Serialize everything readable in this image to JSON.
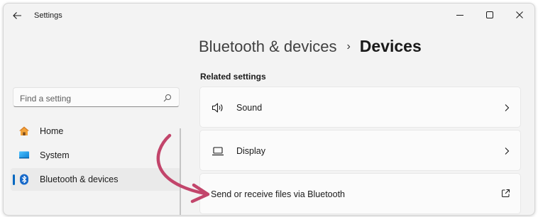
{
  "window": {
    "title": "Settings"
  },
  "header": {
    "parent": "Bluetooth & devices",
    "separator": "›",
    "current": "Devices"
  },
  "search": {
    "placeholder": "Find a setting"
  },
  "sidebar": {
    "items": [
      {
        "label": "Home",
        "icon": "home-icon",
        "active": false
      },
      {
        "label": "System",
        "icon": "system-icon",
        "active": false
      },
      {
        "label": "Bluetooth & devices",
        "icon": "bluetooth-icon",
        "active": true
      }
    ]
  },
  "main": {
    "section_title": "Related settings",
    "cards": [
      {
        "label": "Sound",
        "icon": "speaker-icon",
        "action": "chevron-right-icon"
      },
      {
        "label": "Display",
        "icon": "laptop-icon",
        "action": "chevron-right-icon"
      },
      {
        "label": "Send or receive files via Bluetooth",
        "icon": "",
        "action": "external-link-icon"
      }
    ]
  },
  "colors": {
    "accent": "#0067c0",
    "annotation_arrow": "#c2456b",
    "window_bg": "#f3f3f3",
    "card_bg": "#fbfbfb"
  }
}
